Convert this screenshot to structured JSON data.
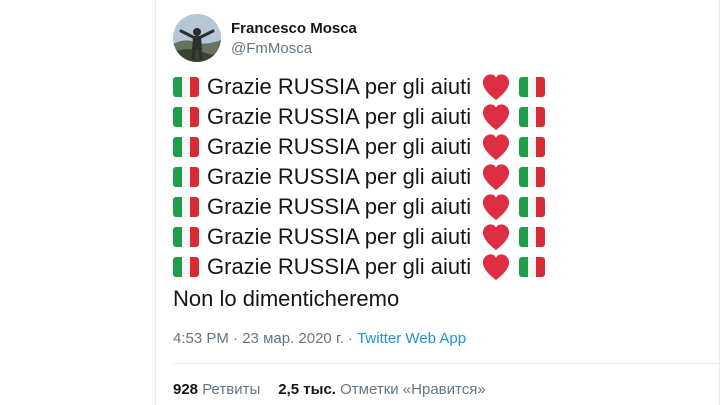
{
  "author": {
    "display_name": "Francesco Mosca",
    "handle": "@FmMosca"
  },
  "tweet": {
    "lines": [
      "Grazie RUSSIA per gli aiuti",
      "Grazie RUSSIA per gli aiuti",
      "Grazie RUSSIA per gli aiuti",
      "Grazie RUSSIA per gli aiuti",
      "Grazie RUSSIA per gli aiuti",
      "Grazie RUSSIA per gli aiuti",
      "Grazie RUSSIA per gli aiuti"
    ],
    "closing_line": "Non lo dimenticheremo",
    "emoji": [
      "italy-flag-icon",
      "red-heart-icon"
    ]
  },
  "meta": {
    "time": "4:53 PM",
    "separator": "·",
    "date": "23 мар. 2020 г.",
    "app": "Twitter Web App"
  },
  "stats": {
    "retweets_count": "928",
    "retweets_label": "Ретвиты",
    "likes_count": "2,5 тыс.",
    "likes_label": "Отметки «Нравится»"
  },
  "colors": {
    "flag_green": "#1f9e4b",
    "flag_white": "#f5f5f5",
    "flag_red": "#d72c33",
    "heart": "#dd2e44",
    "link": "#1b95e0",
    "secondary_text": "#657786"
  }
}
